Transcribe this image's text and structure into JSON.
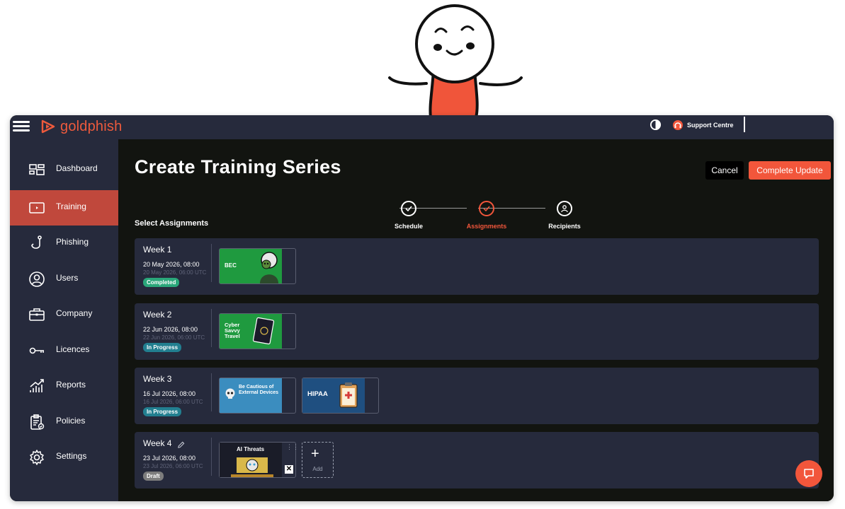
{
  "brand": {
    "name": "goldphish",
    "accent": "#ee5a3c"
  },
  "topbar": {
    "support_label": "Support Centre",
    "support_icon": "headset-icon",
    "contrast_icon": "contrast-icon",
    "menu_icon": "hamburger-icon"
  },
  "sidebar": {
    "items": [
      {
        "label": "Dashboard",
        "icon": "dashboard-icon",
        "active": false
      },
      {
        "label": "Training",
        "icon": "training-icon",
        "active": true
      },
      {
        "label": "Phishing",
        "icon": "phishing-hook-icon",
        "active": false
      },
      {
        "label": "Users",
        "icon": "user-icon",
        "active": false
      },
      {
        "label": "Company",
        "icon": "briefcase-icon",
        "active": false
      },
      {
        "label": "Licences",
        "icon": "key-icon",
        "active": false
      },
      {
        "label": "Reports",
        "icon": "chart-icon",
        "active": false
      },
      {
        "label": "Policies",
        "icon": "clipboard-icon",
        "active": false
      },
      {
        "label": "Settings",
        "icon": "gear-icon",
        "active": false
      }
    ]
  },
  "page": {
    "title": "Create Training Series",
    "cancel_label": "Cancel",
    "complete_label": "Complete Update",
    "section_title": "Select Assignments"
  },
  "stepper": {
    "steps": [
      {
        "label": "Schedule",
        "status": "done"
      },
      {
        "label": "Assignments",
        "status": "current"
      },
      {
        "label": "Recipients",
        "status": "pending"
      }
    ]
  },
  "weeks": [
    {
      "name": "Week 1",
      "date": "20 May 2026, 08:00",
      "utc": "20 May 2026, 06:00 UTC",
      "status": "Completed",
      "modules": [
        {
          "title": "BEC",
          "color": "#1f9a3f"
        }
      ]
    },
    {
      "name": "Week 2",
      "date": "22 Jun 2026, 08:00",
      "utc": "22 Jun 2026, 06:00 UTC",
      "status": "In Progress",
      "modules": [
        {
          "title": "Cyber Savvy Travel",
          "color": "#1f9a3f"
        }
      ]
    },
    {
      "name": "Week 3",
      "date": "16 Jul 2026, 08:00",
      "utc": "16 Jul 2026, 06:00 UTC",
      "status": "In Progress",
      "modules": [
        {
          "title": "Be Cautious of External Devices",
          "color": "#3b8dbf"
        },
        {
          "title": "HIPAA",
          "color": "#1f4f80"
        }
      ]
    },
    {
      "name": "Week 4",
      "date": "23 Jul 2026, 08:00",
      "utc": "23 Jul 2026, 06:00 UTC",
      "status": "Draft",
      "modules": [
        {
          "title": "AI Threats",
          "color": "#1a1c28"
        }
      ],
      "add_label": "Add"
    }
  ]
}
